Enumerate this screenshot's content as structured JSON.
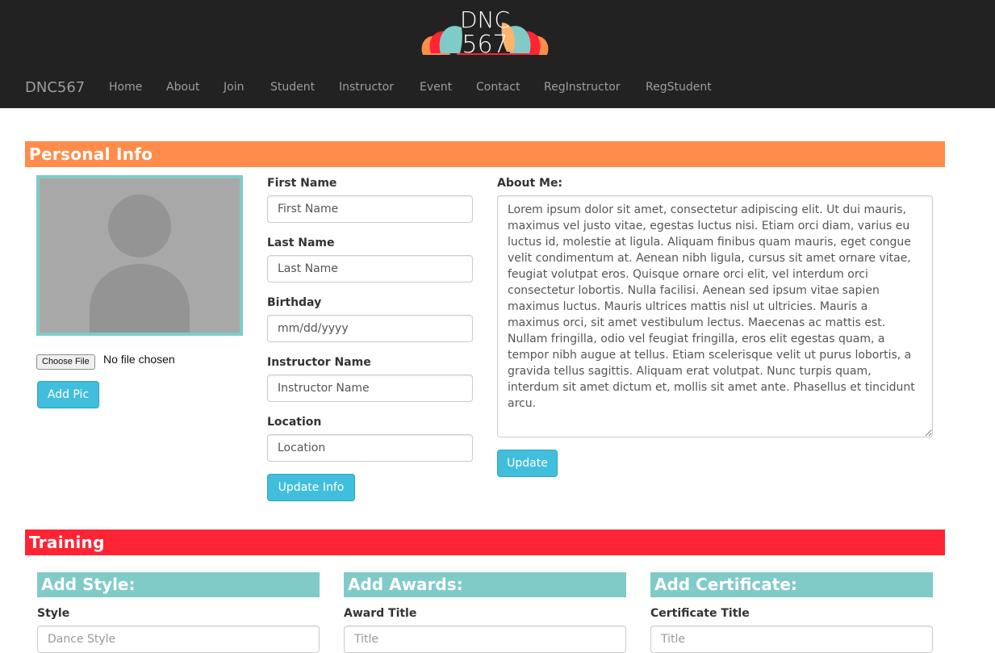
{
  "header": {
    "logo_text_top": "DNC",
    "logo_text_bottom": "567",
    "brand": "DNC567",
    "nav_items": [
      "Home",
      "About",
      "Join",
      "Student",
      "Instructor",
      "Event",
      "Contact",
      "RegInstructor",
      "RegStudent"
    ]
  },
  "personal": {
    "section_title": "Personal Info",
    "avatar_icon": "person-silhouette-icon",
    "file_button": "Choose File",
    "file_status": "No file chosen",
    "add_pic_button": "Add Pic",
    "first_name_label": "First Name",
    "first_name_placeholder": "First Name",
    "last_name_label": "Last Name",
    "last_name_placeholder": "Last Name",
    "birthday_label": "Birthday",
    "birthday_placeholder": "mm/dd/yyyy",
    "instructor_label": "Instructor Name",
    "instructor_placeholder": "Instructor Name",
    "location_label": "Location",
    "location_placeholder": "Location",
    "update_info_button": "Update Info",
    "about_label": "About Me:",
    "about_text": "Lorem ipsum dolor sit amet, consectetur adipiscing elit. Ut dui mauris, maximus vel justo vitae, egestas luctus nisi. Etiam orci diam, varius eu luctus id, molestie at ligula. Aliquam finibus quam mauris, eget congue velit condimentum at. Aenean nibh ligula, cursus sit amet ornare vitae, feugiat volutpat eros. Quisque ornare orci elit, vel interdum orci consectetur lobortis. Nulla facilisi. Aenean sed ipsum vitae sapien maximus luctus. Mauris ultrices mattis nisl ut ultricies. Mauris a maximus orci, sit amet vestibulum lectus. Maecenas ac mattis est. Nullam fringilla, odio vel feugiat fringilla, eros elit egestas quam, a tempor nibh augue at tellus. Etiam scelerisque velit ut purus lobortis, a gravida tellus sagittis. Aliquam erat volutpat. Nunc turpis quam, interdum sit amet dictum et, mollis sit amet ante. Phasellus et tincidunt arcu.",
    "update_button": "Update"
  },
  "training": {
    "section_title": "Training",
    "style_header": "Add Style:",
    "style_label": "Style",
    "style_placeholder": "Dance Style",
    "awards_header": "Add Awards:",
    "award_label": "Award Title",
    "award_placeholder": "Title",
    "cert_header": "Add Certificate:",
    "cert_label": "Certificate Title",
    "cert_placeholder": "Title"
  },
  "colors": {
    "header_bg": "#222222",
    "personal_bar": "#ff8c4a",
    "training_bar": "#ff2433",
    "teal": "#80cbc8",
    "button": "#41bedc"
  }
}
